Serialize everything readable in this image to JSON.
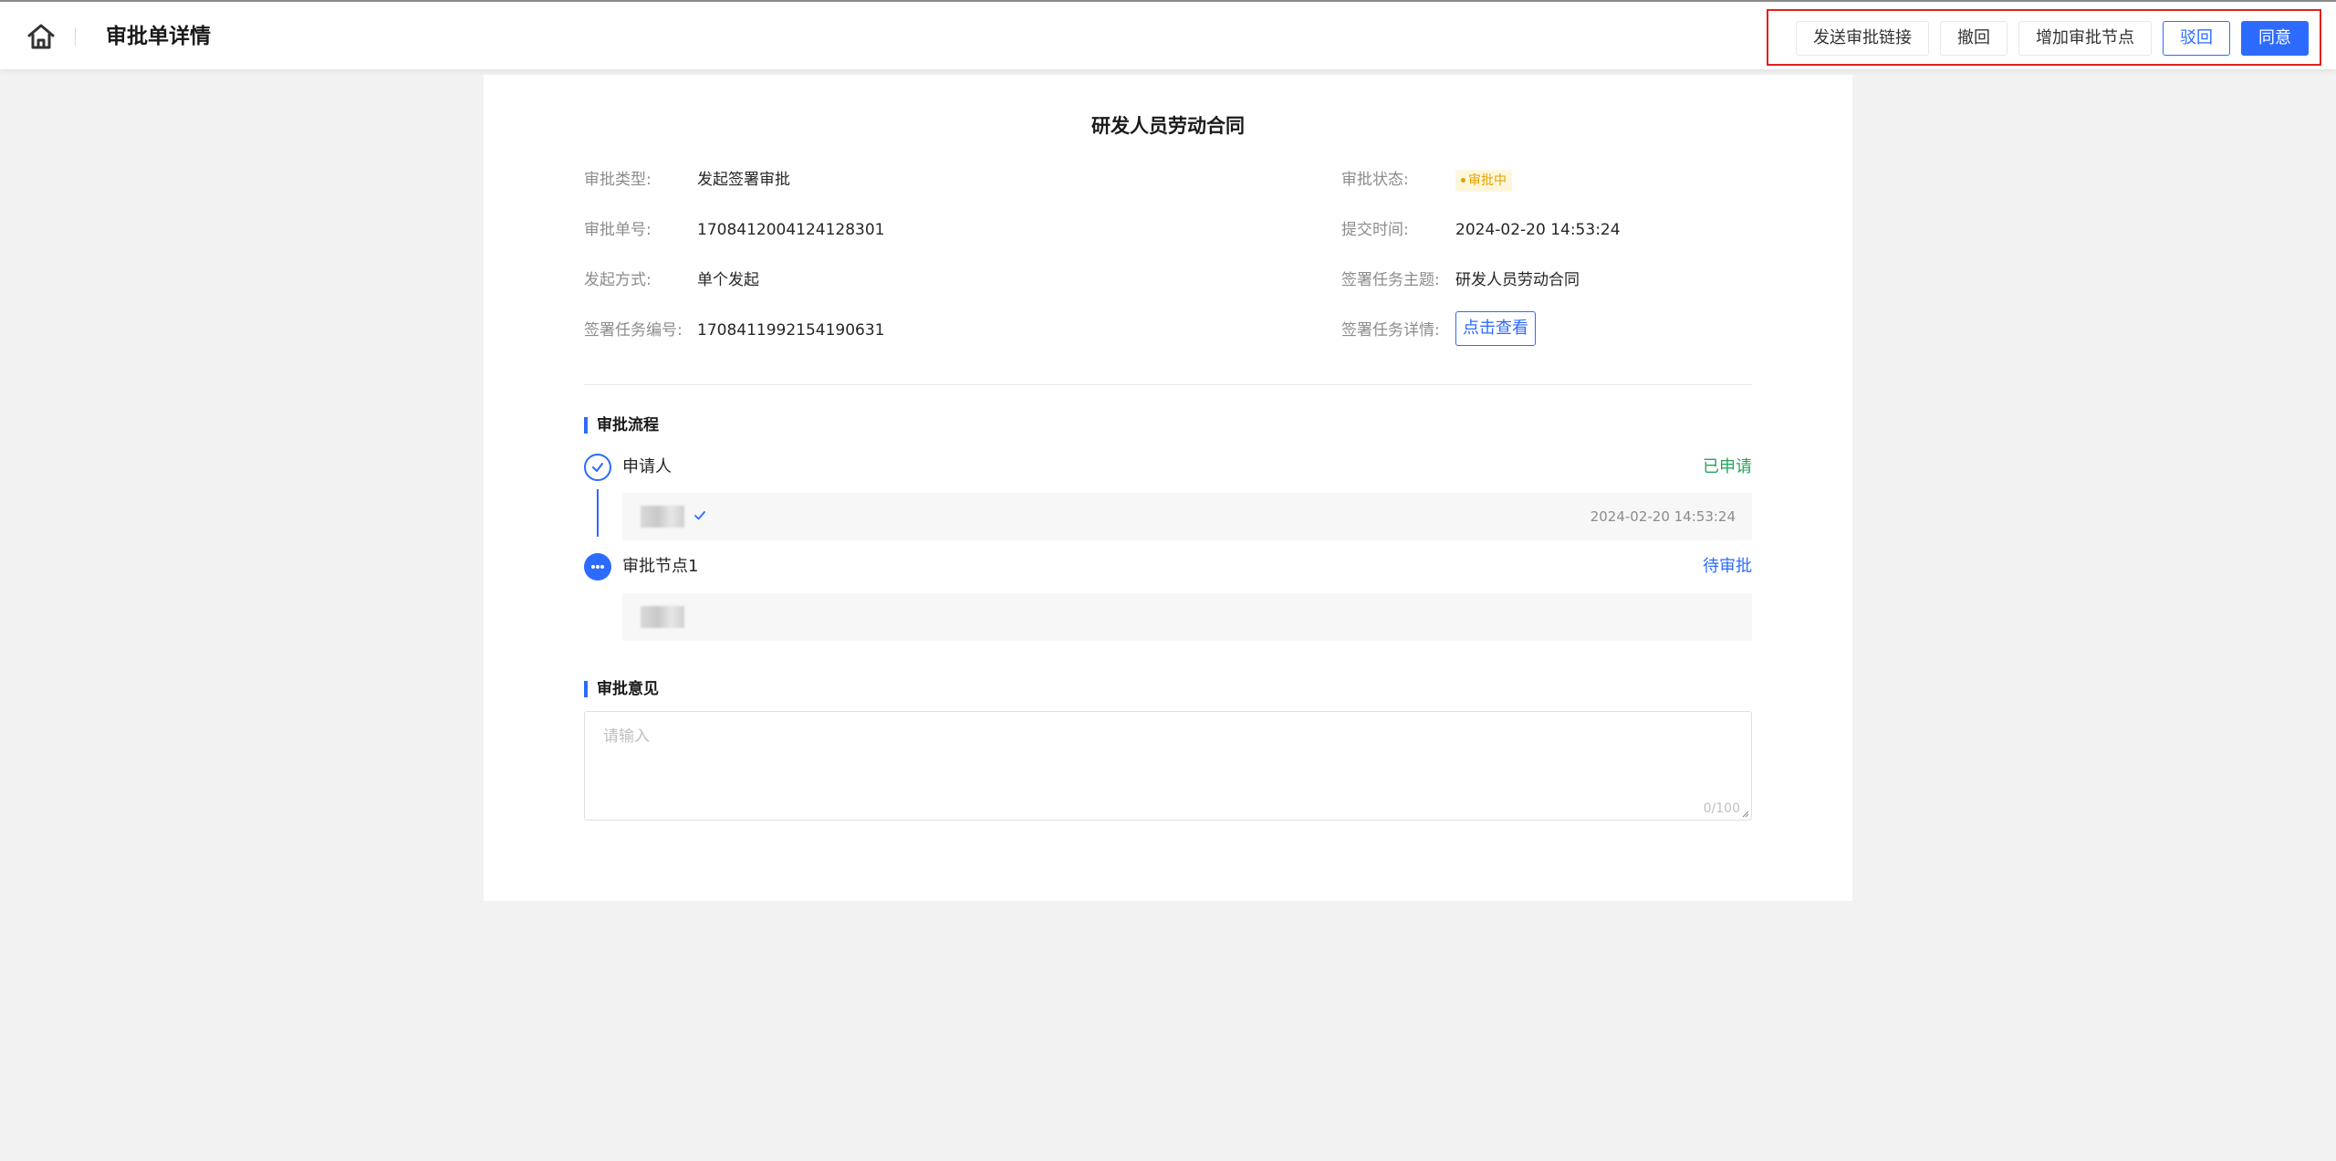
{
  "header": {
    "title": "审批单详情",
    "home_icon": "home-icon"
  },
  "actions": {
    "send_link": "发送审批链接",
    "withdraw": "撤回",
    "add_node": "增加审批节点",
    "reject": "驳回",
    "approve": "同意"
  },
  "colors": {
    "primary": "#2d6bff",
    "highlight_border": "#e02020",
    "status_pending_bg": "#fff7dc",
    "status_pending_text": "#e0a300",
    "applied_green": "#27a35a"
  },
  "document": {
    "title": "研发人员劳动合同",
    "fields": {
      "type_label": "审批类型:",
      "type_value": "发起签署审批",
      "status_label": "审批状态:",
      "status_value": "审批中",
      "number_label": "审批单号:",
      "number_value": "1708412004124128301",
      "submit_time_label": "提交时间:",
      "submit_time_value": "2024-02-20 14:53:24",
      "method_label": "发起方式:",
      "method_value": "单个发起",
      "task_subject_label": "签署任务主题:",
      "task_subject_value": "研发人员劳动合同",
      "task_number_label": "签署任务编号:",
      "task_number_value": "1708411992154190631",
      "task_detail_label": "签署任务详情:",
      "task_detail_button": "点击查看"
    }
  },
  "flow": {
    "title": "审批流程",
    "steps": [
      {
        "name": "申请人",
        "status": "已申请",
        "time": "2024-02-20 14:53:24",
        "icon": "check-circle-icon"
      },
      {
        "name": "审批节点1",
        "status": "待审批",
        "time": "",
        "icon": "more-dots-icon"
      }
    ]
  },
  "opinion": {
    "title": "审批意见",
    "placeholder": "请输入",
    "count": "0/100"
  }
}
